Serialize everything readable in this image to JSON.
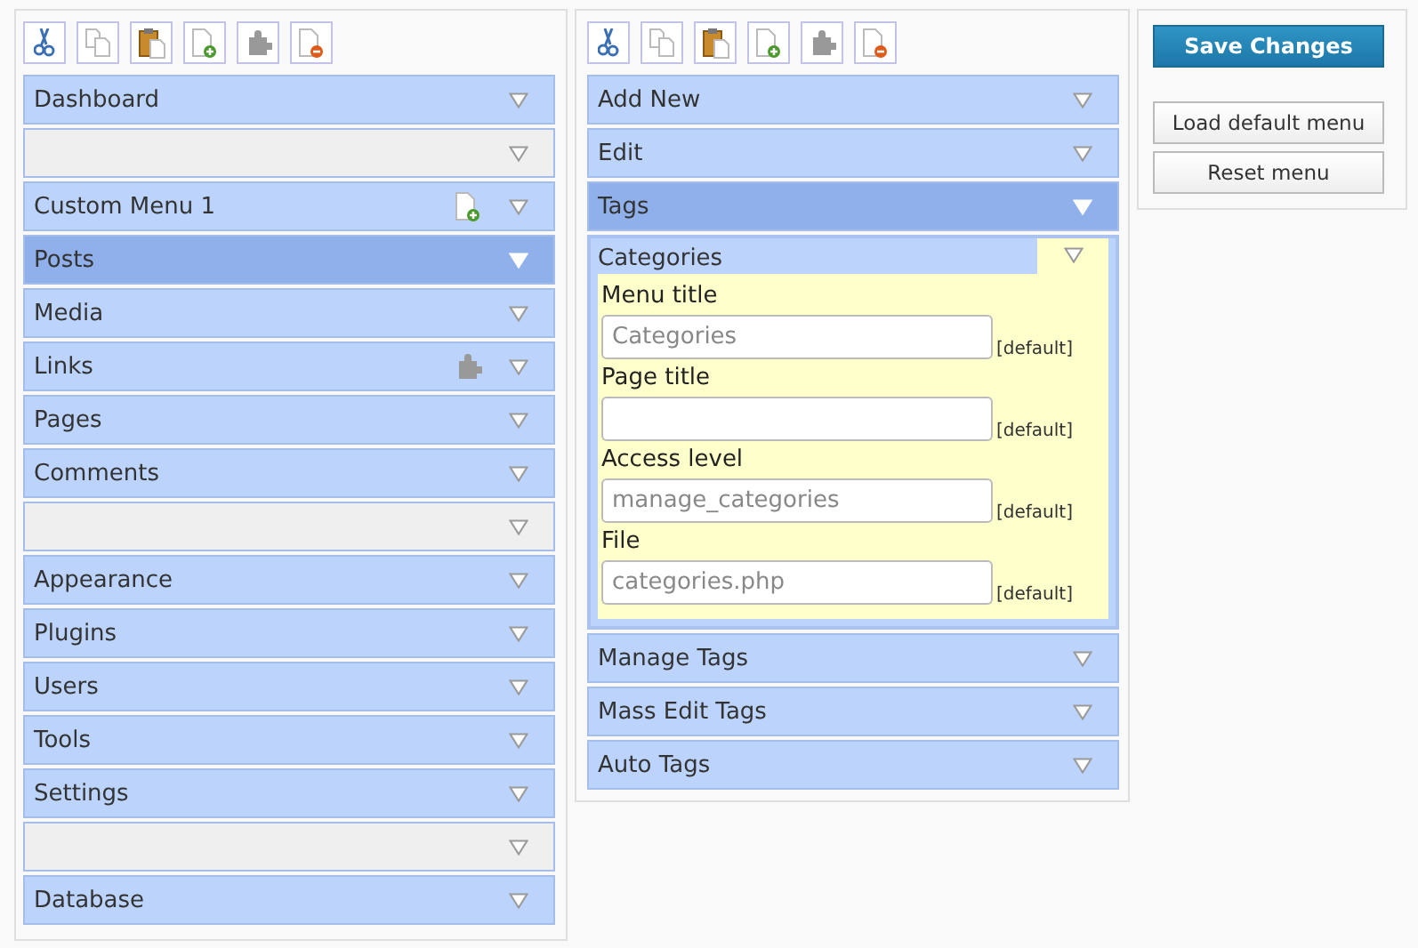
{
  "left_panel": {
    "toolbar": [
      {
        "kind": "cut"
      },
      {
        "kind": "copy"
      },
      {
        "kind": "paste"
      },
      {
        "kind": "new"
      },
      {
        "kind": "plugin"
      },
      {
        "kind": "delete"
      }
    ],
    "items": [
      {
        "kind": "item",
        "label": "Dashboard",
        "selected": false,
        "custom": false,
        "plugin": false
      },
      {
        "kind": "separator",
        "selected": false,
        "custom": false,
        "plugin": false
      },
      {
        "kind": "item",
        "label": "Custom Menu 1",
        "selected": false,
        "custom": true,
        "plugin": false
      },
      {
        "kind": "item",
        "label": "Posts",
        "selected": true,
        "custom": false,
        "plugin": false
      },
      {
        "kind": "item",
        "label": "Media",
        "selected": false,
        "custom": false,
        "plugin": false
      },
      {
        "kind": "item",
        "label": "Links",
        "selected": false,
        "custom": false,
        "plugin": true
      },
      {
        "kind": "item",
        "label": "Pages",
        "selected": false,
        "custom": false,
        "plugin": false
      },
      {
        "kind": "item",
        "label": "Comments",
        "selected": false,
        "custom": false,
        "plugin": false
      },
      {
        "kind": "separator",
        "selected": false,
        "custom": false,
        "plugin": false
      },
      {
        "kind": "item",
        "label": "Appearance",
        "selected": false,
        "custom": false,
        "plugin": false
      },
      {
        "kind": "item",
        "label": "Plugins",
        "selected": false,
        "custom": false,
        "plugin": false
      },
      {
        "kind": "item",
        "label": "Users",
        "selected": false,
        "custom": false,
        "plugin": false
      },
      {
        "kind": "item",
        "label": "Tools",
        "selected": false,
        "custom": false,
        "plugin": false
      },
      {
        "kind": "item",
        "label": "Settings",
        "selected": false,
        "custom": false,
        "plugin": false
      },
      {
        "kind": "separator",
        "selected": false,
        "custom": false,
        "plugin": false
      },
      {
        "kind": "item",
        "label": "Database",
        "selected": false,
        "custom": false,
        "plugin": false
      }
    ]
  },
  "middle_panel": {
    "toolbar": [
      {
        "kind": "cut"
      },
      {
        "kind": "copy"
      },
      {
        "kind": "paste"
      },
      {
        "kind": "new"
      },
      {
        "kind": "plugin"
      },
      {
        "kind": "delete"
      }
    ],
    "items": [
      {
        "kind": "item",
        "label": "Add New",
        "selected": false,
        "expanded": false
      },
      {
        "kind": "item",
        "label": "Edit",
        "selected": false,
        "expanded": false
      },
      {
        "kind": "item",
        "label": "Tags",
        "selected": true,
        "expanded": false
      },
      {
        "kind": "item",
        "label": "Categories",
        "selected": false,
        "expanded": true,
        "fields": [
          {
            "label": "Menu title",
            "placeholder": "Categories",
            "default_link": "[default]"
          },
          {
            "label": "Page title",
            "default_link": "[default]"
          },
          {
            "label": "Access level",
            "placeholder": "manage_categories",
            "default_link": "[default]"
          },
          {
            "label": "File",
            "placeholder": "categories.php",
            "default_link": "[default]"
          }
        ]
      },
      {
        "kind": "item",
        "label": "Manage Tags",
        "selected": false,
        "expanded": false
      },
      {
        "kind": "item",
        "label": "Mass Edit Tags",
        "selected": false,
        "expanded": false
      },
      {
        "kind": "item",
        "label": "Auto Tags",
        "selected": false,
        "expanded": false
      }
    ]
  },
  "actions": {
    "save": "Save Changes",
    "buttons": [
      "Load default menu",
      "Reset menu"
    ]
  }
}
